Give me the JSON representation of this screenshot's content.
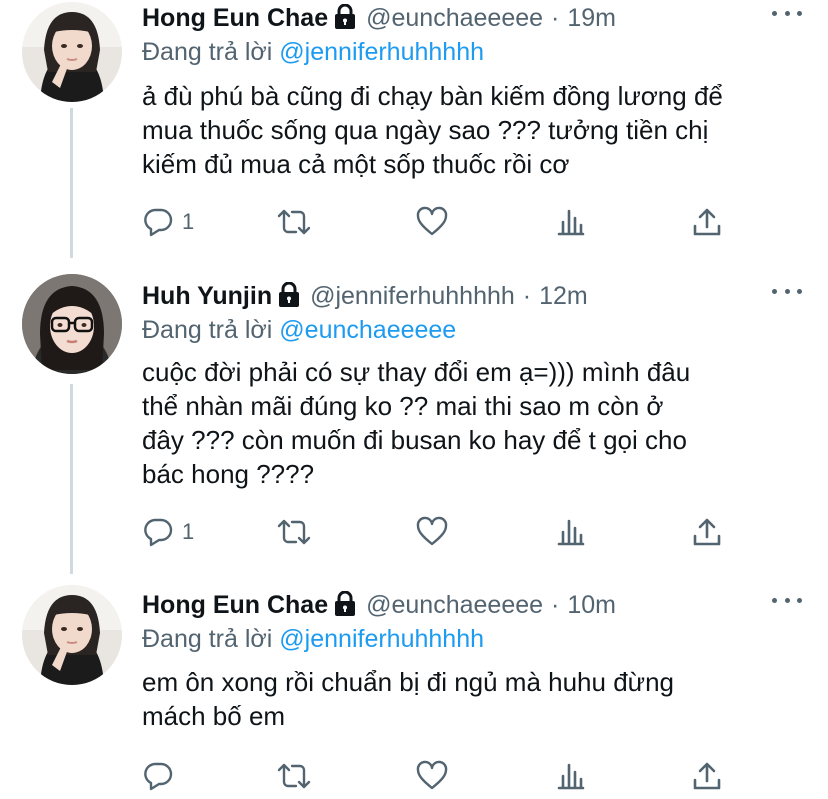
{
  "tweets": [
    {
      "author": "Hong Eun Chae",
      "handle": "@eunchaeeeee",
      "dot": "·",
      "time": "19m",
      "reply_prefix": "Đang trả lời",
      "reply_to": "@jenniferhuhhhhh",
      "lines": [
        "ả đù phú bà cũng đi chạy bàn kiếm đồng lương để",
        "mua thuốc sống qua ngày sao ??? tưởng tiền chị",
        "kiếm đủ mua cả một sốp thuốc rồi cơ"
      ],
      "reply_count": "1",
      "avatar_icon": "person-photo-avatar"
    },
    {
      "author": "Huh Yunjin",
      "handle": "@jenniferhuhhhhh",
      "dot": "·",
      "time": "12m",
      "reply_prefix": "Đang trả lời",
      "reply_to": "@eunchaeeeee",
      "lines": [
        "cuộc đời phải có sự thay đổi em ạ=))) mình đâu",
        "thể nhàn mãi đúng ko ?? mai thi sao m còn ở",
        "đây ??? còn muốn đi busan ko hay để t gọi cho",
        "bác hong ????"
      ],
      "reply_count": "1",
      "avatar_icon": "person-photo-avatar"
    },
    {
      "author": "Hong Eun Chae",
      "handle": "@eunchaeeeee",
      "dot": "·",
      "time": "10m",
      "reply_prefix": "Đang trả lời",
      "reply_to": "@jenniferhuhhhhh",
      "lines": [
        "em ôn xong rồi chuẩn bị đi ngủ mà huhu đừng",
        "mách bố em"
      ],
      "reply_count": "",
      "avatar_icon": "person-photo-avatar"
    }
  ],
  "icons": [
    "lock-icon",
    "more-icon",
    "reply-icon",
    "retweet-icon",
    "like-icon",
    "analytics-icon",
    "share-icon"
  ],
  "colors": {
    "text": "#0f1419",
    "secondary": "#536471",
    "link": "#1d9bf0",
    "thread_line": "#cfd9de",
    "background": "#ffffff"
  }
}
